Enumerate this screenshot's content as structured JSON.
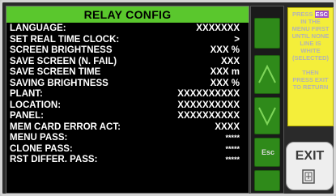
{
  "title": "RELAY CONFIG",
  "rows": [
    {
      "label": "LANGUAGE:",
      "value": "XXXXXXX"
    },
    {
      "label": "SET REAL TIME CLOCK:",
      "value": ">"
    },
    {
      "label": "SCREEN BRIGHTNESS",
      "value": "XXX %"
    },
    {
      "label": "SAVE SCREEN (N. FAIL)",
      "value": "XXX"
    },
    {
      "label": "SAVE SCREEN TIME",
      "value": "XXX m"
    },
    {
      "label": "SAVING BRIGHTNESS",
      "value": "XXX %"
    },
    {
      "label": "PLANT:",
      "value": "XXXXXXXXXX"
    },
    {
      "label": "LOCATION:",
      "value": "XXXXXXXXXX"
    },
    {
      "label": "PANEL:",
      "value": "XXXXXXXXXX"
    },
    {
      "label": "MEM CARD ERROR ACT:",
      "value": "XXXX"
    },
    {
      "label": "MENU PASS:",
      "value": "*****"
    },
    {
      "label": "CLONE PASS:",
      "value": "*****"
    },
    {
      "label": "RST DIFFER. PASS:",
      "value": "*****"
    }
  ],
  "side_buttons": {
    "esc_label": "Esc"
  },
  "info_box": {
    "line1_prefix": "PRESS",
    "line1_tag": "ESC",
    "lines": [
      "IN THE",
      "MENU FIRST",
      "UNTIL NONE",
      "LINE IS",
      "WHITE",
      "(SELECTED)",
      "",
      "THEN",
      "PRESS EXIT",
      "TO RETURN"
    ]
  },
  "exit_button": {
    "label": "EXIT"
  },
  "colors": {
    "title_bar": "#5ac72d",
    "button_green": "#2f8a1a",
    "info_yellow": "#f4ee3a",
    "esc_tag": "#a050c8"
  }
}
